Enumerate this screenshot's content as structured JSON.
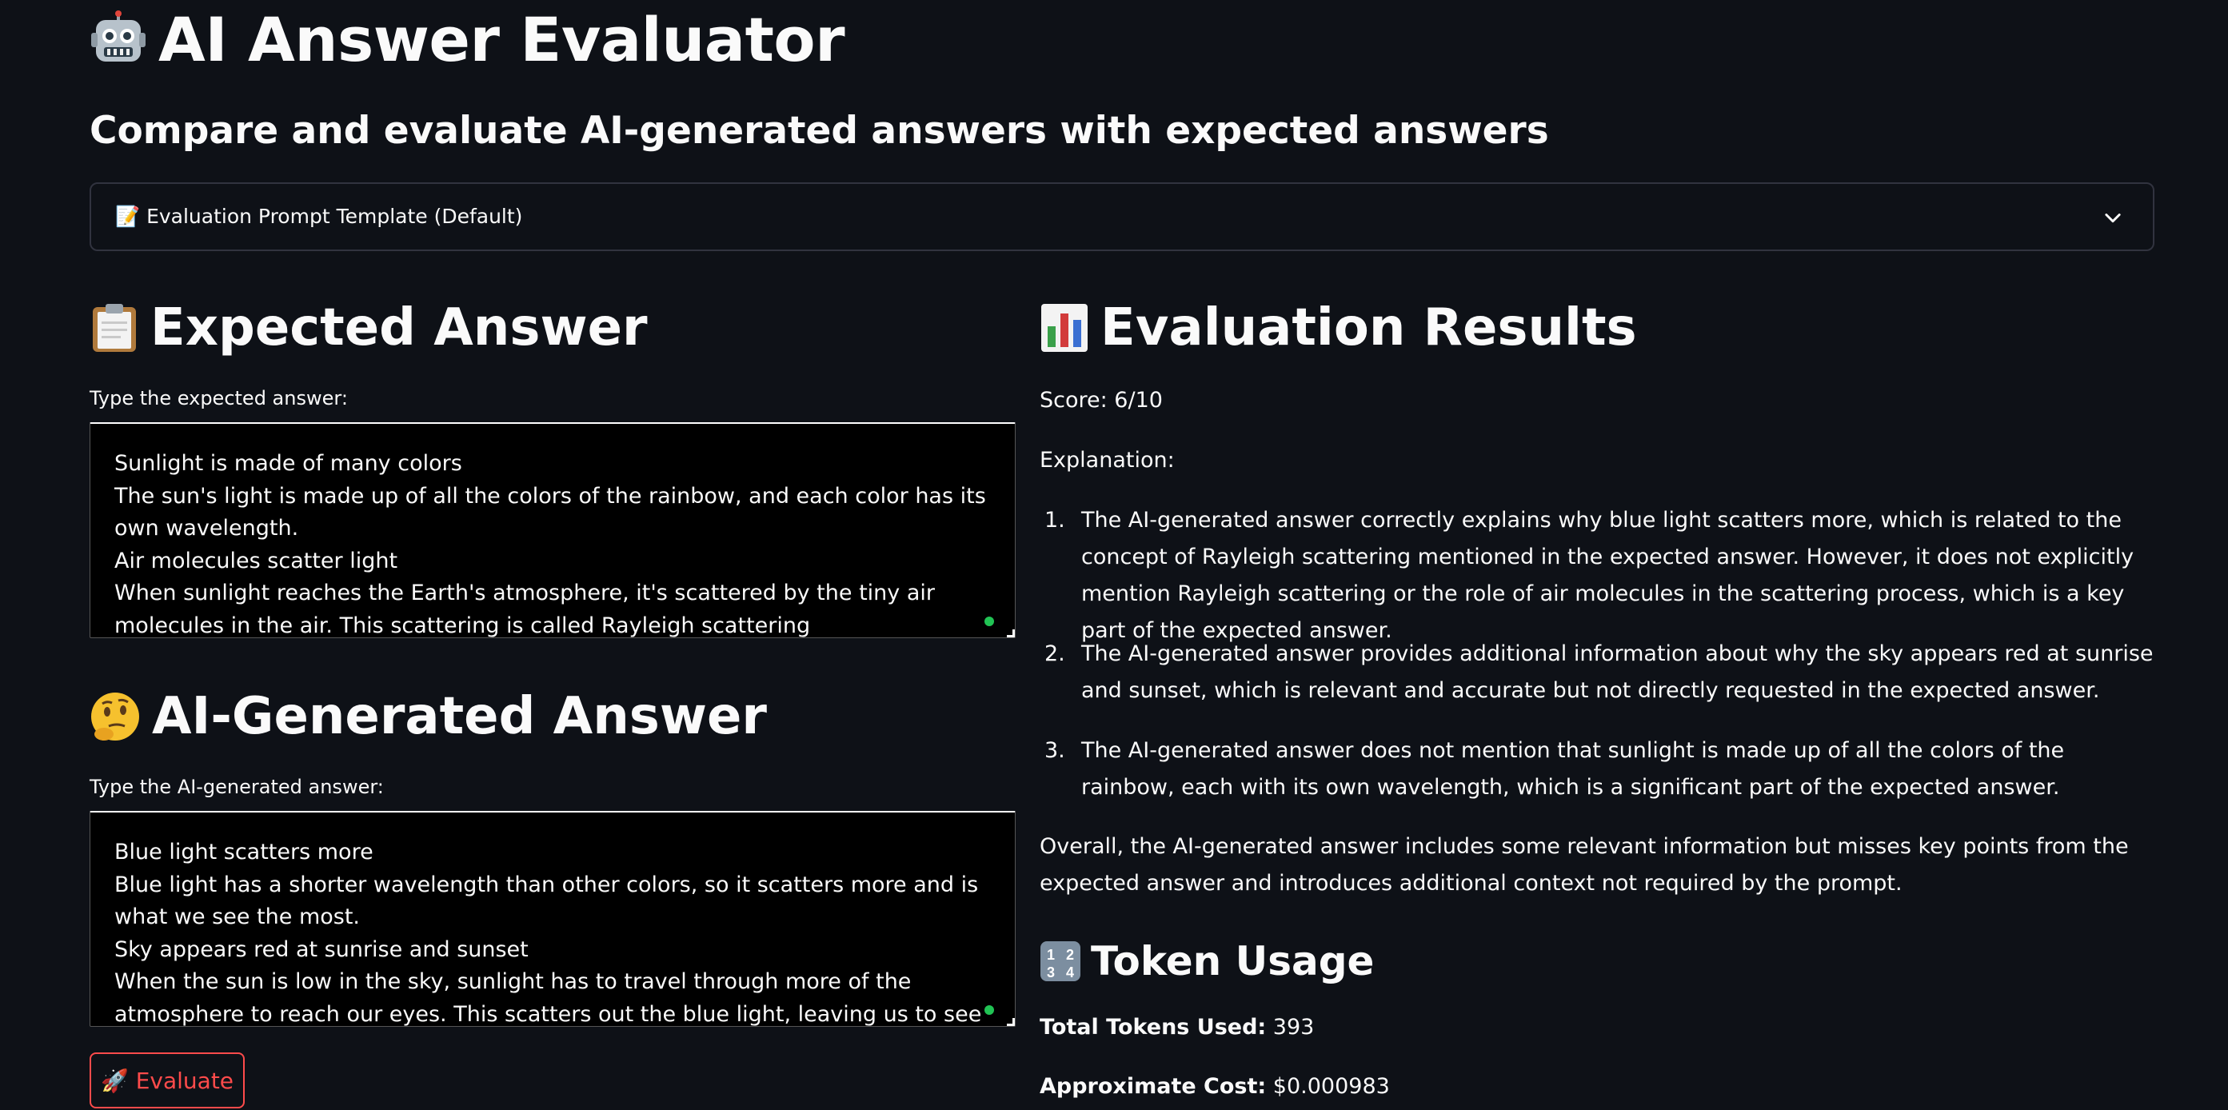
{
  "app": {
    "title": "AI Answer Evaluator",
    "title_icon": "robot-emoji",
    "subtitle": "Compare and evaluate AI-generated answers with expected answers"
  },
  "expander": {
    "icon": "memo-emoji",
    "label": "📝 Evaluation Prompt Template (Default)"
  },
  "expected": {
    "heading_icon": "clipboard-emoji",
    "heading": "Expected Answer",
    "label": "Type the expected answer:",
    "value": "Sunlight is made of many colors\nThe sun's light is made up of all the colors of the rainbow, and each color has its own wavelength.\nAir molecules scatter light\nWhen sunlight reaches the Earth's atmosphere, it's scattered by the tiny air molecules in the air. This scattering is called Rayleigh scattering"
  },
  "generated": {
    "heading_icon": "thinking-face-emoji",
    "heading": "AI-Generated Answer",
    "label": "Type the AI-generated answer:",
    "value": "Blue light scatters more\nBlue light has a shorter wavelength than other colors, so it scatters more and is what we see the most.\nSky appears red at sunrise and sunset\nWhen the sun is low in the sky, sunlight has to travel through more of the atmosphere to reach our eyes. This scatters out the blue light, leaving us to see more red and orange."
  },
  "evaluate_button": {
    "label": "🚀 Evaluate"
  },
  "results": {
    "heading_icon": "bar-chart-emoji",
    "heading": "Evaluation Results",
    "score": "Score: 6/10",
    "explanation_label": "Explanation:",
    "items": [
      {
        "num": "1.",
        "text": "The AI-generated answer correctly explains why blue light scatters more, which is related to the concept of Rayleigh scattering mentioned in the expected answer. However, it does not explicitly mention Rayleigh scattering or the role of air molecules in the scattering process, which is a key part of the expected answer."
      },
      {
        "num": "2.",
        "text": "The AI-generated answer provides additional information about why the sky appears red at sunrise and sunset, which is relevant and accurate but not directly requested in the expected answer."
      },
      {
        "num": "3.",
        "text": "The AI-generated answer does not mention that sunlight is made up of all the colors of the rainbow, each with its own wavelength, which is a significant part of the expected answer."
      }
    ],
    "overall": "Overall, the AI-generated answer includes some relevant information but misses key points from the expected answer and introduces additional context not required by the prompt."
  },
  "tokens": {
    "heading_icon": "numbers-emoji",
    "heading": "Token Usage",
    "total_label": "Total Tokens Used:",
    "total_value": " 393",
    "cost_label": "Approximate Cost:",
    "cost_value": " $0.000983"
  },
  "colors": {
    "background": "#0e1117",
    "text": "#fafafa",
    "accent": "#ff4b4b",
    "textarea_bg": "#000000",
    "status_dot": "#21c354"
  }
}
